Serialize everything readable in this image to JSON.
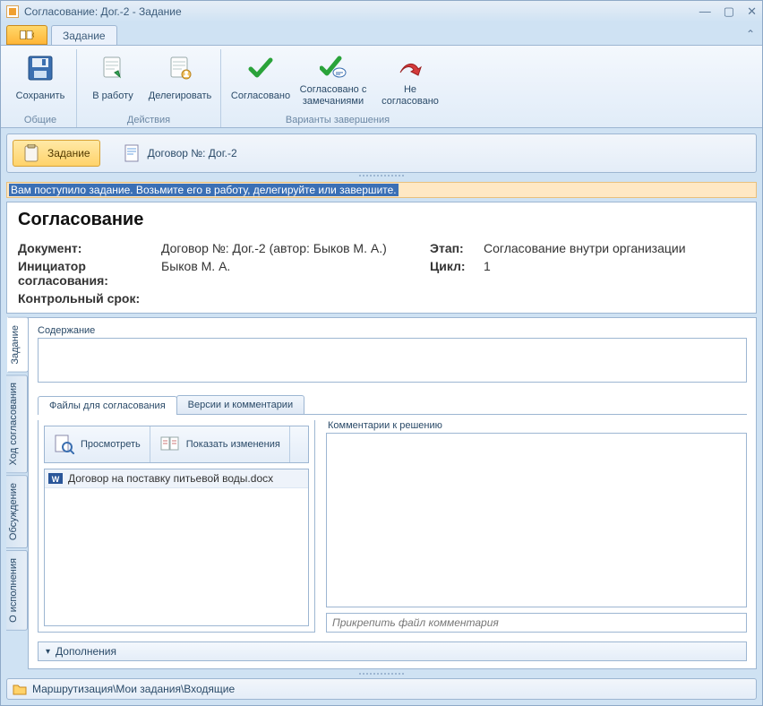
{
  "window": {
    "title": "Согласование: Дог.-2 - Задание"
  },
  "ribbon": {
    "tab": "Задание",
    "groups": {
      "general": {
        "label": "Общие",
        "save": "Сохранить"
      },
      "actions": {
        "label": "Действия",
        "to_work": "В работу",
        "delegate": "Делегировать"
      },
      "finish": {
        "label": "Варианты завершения",
        "approved": "Согласовано",
        "approved_with_notes": "Согласовано с замечаниями",
        "rejected": "Не согласовано"
      }
    }
  },
  "nav": {
    "task": "Задание",
    "doc": "Договор №: Дог.-2"
  },
  "banner": "Вам поступило задание. Возьмите его в работу, делегируйте или завершите.",
  "header": {
    "title": "Согласование",
    "labels": {
      "document": "Документ:",
      "stage": "Этап:",
      "initiator": "Инициатор согласования:",
      "cycle": "Цикл:",
      "deadline": "Контрольный срок:"
    },
    "values": {
      "document": "Договор №: Дог.-2 (автор: Быков М. А.)",
      "stage": "Согласование внутри организации",
      "initiator": "Быков М. А.",
      "cycle": "1",
      "deadline": ""
    }
  },
  "vtabs": {
    "task": "Задание",
    "flow": "Ход согласования",
    "discussion": "Обсуждение",
    "exec": "О исполнения"
  },
  "content": {
    "label": "Содержание",
    "value": ""
  },
  "htabs": {
    "files": "Файлы для согласования",
    "versions": "Версии и комментарии"
  },
  "file_toolbar": {
    "view": "Просмотреть",
    "changes": "Показать изменения"
  },
  "files": [
    "Договор на поставку питьевой воды.docx"
  ],
  "comments": {
    "label": "Комментарии к решению",
    "attach_placeholder": "Прикрепить файл комментария"
  },
  "additions": "Дополнения",
  "statusbar": "Маршрутизация\\Мои задания\\Входящие"
}
